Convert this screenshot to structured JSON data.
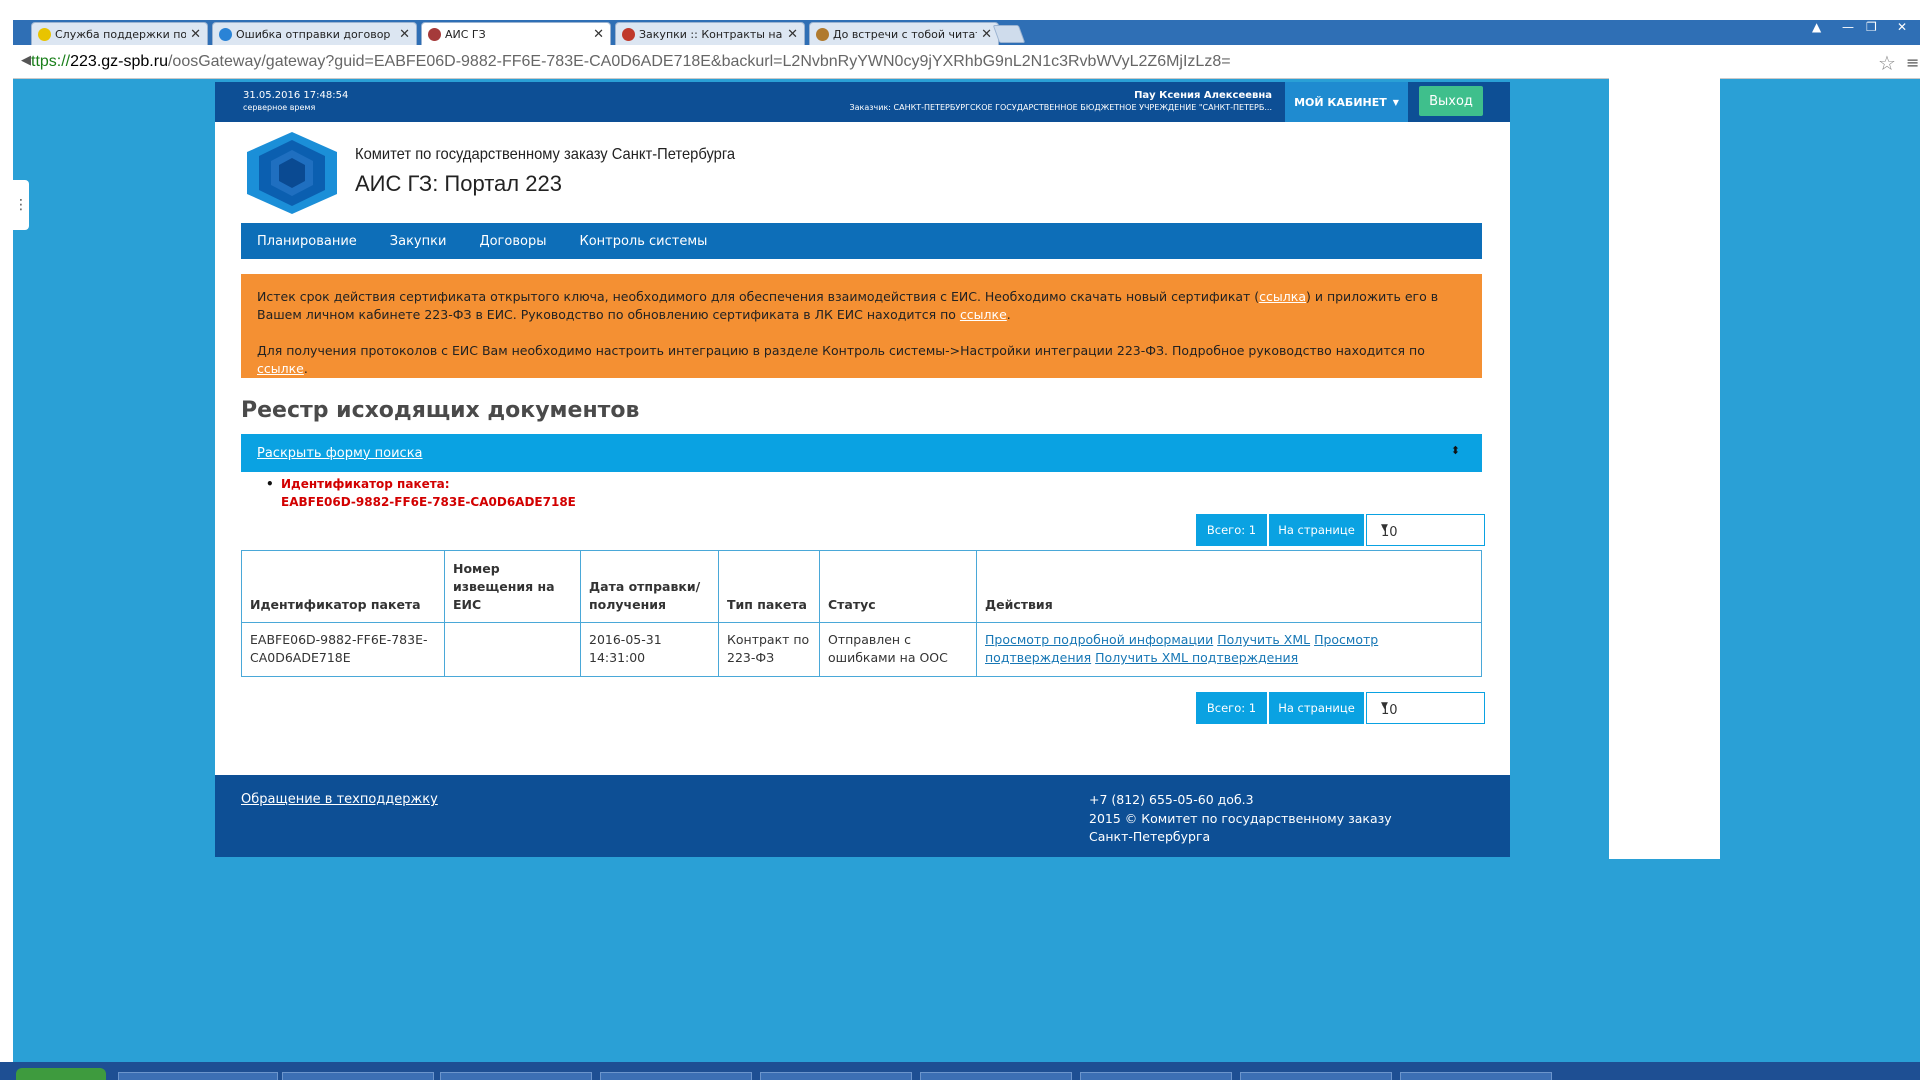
{
  "browser": {
    "tabs": [
      {
        "title": "Служба поддержки пользо",
        "icon_color": "#e8c400"
      },
      {
        "title": "Ошибка отправки договор",
        "icon_color": "#2a83d6"
      },
      {
        "title": "АИС ГЗ",
        "icon_color": "#a53a3a"
      },
      {
        "title": "Закупки :: Контракты на з",
        "icon_color": "#c0392b"
      },
      {
        "title": "До встречи с тобой читать",
        "icon_color": "#b07a2e"
      }
    ],
    "address": {
      "prefix": "ttps://",
      "host": "223.gz-spb.ru",
      "path": "/oosGateway/gateway?guid=EABFE06D-9882-FF6E-783E-CA0D6ADE718E&backurl=L2NvbnRyYWN0cy9jYXRhbG9nL2N1c3RvbWVyL2Z6MjIzLz8="
    }
  },
  "topbar": {
    "datetime": "31.05.2016 17:48:54",
    "server_label": "серверное время",
    "user_name": "Пау Ксения Алексеевна",
    "customer": "Заказчик: САНКТ-ПЕТЕРБУРГСКОЕ ГОСУДАРСТВЕННОЕ БЮДЖЕТНОЕ УЧРЕЖДЕНИЕ \"САНКТ-ПЕТЕРБ...",
    "cabinet_label": "МОЙ КАБИНЕТ",
    "exit_label": "Выход"
  },
  "header": {
    "org_name": "Комитет по государственному заказу Санкт-Петербурга",
    "portal_name": "АИС ГЗ: Портал 223"
  },
  "nav": {
    "items": [
      "Планирование",
      "Закупки",
      "Договоры",
      "Контроль системы"
    ]
  },
  "alert": {
    "p1_a": "Истек срок действия сертификата открытого ключа, необходимого для обеспечения взаимодействия с ЕИС. Необходимо скачать новый сертификат (",
    "p1_link": "ссылка",
    "p1_b": ") и приложить его в Вашем личном кабинете 223-ФЗ в ЕИС. Руководство по обновлению сертификата в ЛК ЕИС находится по ",
    "p1_link2": "ссылке",
    "p1_c": ".",
    "p2_a": "Для получения протоколов с ЕИС Вам необходимо настроить интеграцию в разделе Контроль системы->Настройки интеграции 223-ФЗ. Подробное руководство находится по ",
    "p2_link": "ссылке",
    "p2_b": "."
  },
  "main": {
    "title": "Реестр исходящих документов",
    "search_link": "Раскрыть форму поиска",
    "filter_label": "Идентификатор пакета:",
    "filter_value": "EABFE06D-9882-FF6E-783E-CA0D6ADE718E",
    "pager": {
      "total": "Всего: 1",
      "per_page_label": "На странице",
      "per_page_value": "10"
    },
    "table": {
      "headers": [
        "Идентификатор пакета",
        "Номер извещения на ЕИС",
        "Дата отправки/ получения",
        "Тип пакета",
        "Статус",
        "Действия"
      ],
      "rows": [
        {
          "id": "EABFE06D-9882-FF6E-783E-CA0D6ADE718E",
          "notice": "",
          "date": "2016-05-31 14:31:00",
          "type": "Контракт по 223-ФЗ",
          "status": "Отправлен с ошибками на ООС",
          "actions": [
            "Просмотр подробной информации",
            "Получить XML",
            "Просмотр подтверждения",
            "Получить XML подтверждения"
          ]
        }
      ]
    }
  },
  "footer": {
    "support_link": "Обращение в техподдержку",
    "phone": "+7 (812) 655-05-60 доб.3",
    "copyright": "2015 © Комитет по государственному заказу Санкт-Петербурга"
  },
  "colors": {
    "outer_bg": "#2aa0d6",
    "topbar": "#0d4f95",
    "nav": "#0d6eb8",
    "alert": "#f49033",
    "accent": "#0aa2e2",
    "exit_button": "#3fbf8c"
  }
}
